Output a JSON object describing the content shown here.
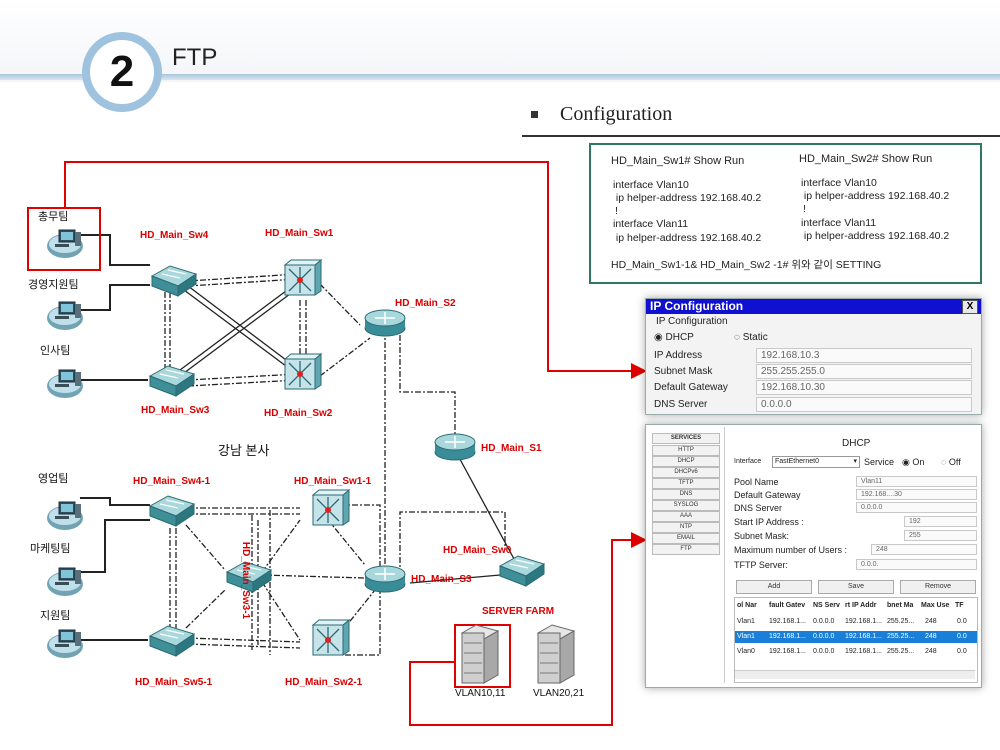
{
  "slide": {
    "number": "2",
    "title": "FTP"
  },
  "config": {
    "heading": "Configuration",
    "sw1_title": "HD_Main_Sw1# Show Run",
    "sw2_title": "HD_Main_Sw2# Show Run",
    "sw1_lines": [
      "interface Vlan10",
      " ip helper-address 192.168.40.2",
      "!",
      "interface Vlan11",
      " ip helper-address 192.168.40.2"
    ],
    "sw2_lines": [
      "interface Vlan10",
      " ip helper-address 192.168.40.2",
      "!",
      "interface Vlan11",
      " ip helper-address 192.168.40.2"
    ],
    "note": "HD_Main_Sw1-1& HD_Main_Sw2 -1# 위와 같이 SETTING"
  },
  "network": {
    "devices": {
      "sw4": "HD_Main_Sw4",
      "sw1": "HD_Main_Sw1",
      "s2": "HD_Main_S2",
      "sw3": "HD_Main_Sw3",
      "sw2": "HD_Main_Sw2",
      "s1": "HD_Main_S1",
      "sw41": "HD_Main_Sw4-1",
      "sw11": "HD_Main_Sw1-1",
      "sw31": "HD_Main_Sw3-1",
      "sw0": "HD_Main_Sw0",
      "s3": "HD_Main_S3",
      "server_farm": "SERVER FARM",
      "sw51": "HD_Main_Sw5-1",
      "sw21": "HD_Main_Sw2-1"
    },
    "teams": {
      "general": "총무팀",
      "management": "경영지원팀",
      "hr": "인사팀",
      "sales": "영업팀",
      "marketing": "마케팅팀",
      "support": "지원팀"
    },
    "site": "강남 본사",
    "servers": {
      "server1": "VLAN10,11",
      "server2": "VLAN20,21"
    },
    "colors": {
      "label_red": "#d80000",
      "link_red": "#e00000"
    }
  },
  "ip_window": {
    "title": "IP Configuration",
    "close": "X",
    "section": "IP Configuration",
    "dhcp_label": "DHCP",
    "static_label": "Static",
    "mode": "DHCP",
    "fields": [
      {
        "label": "IP Address",
        "value": "192.168.10.3"
      },
      {
        "label": "Subnet Mask",
        "value": "255.255.255.0"
      },
      {
        "label": "Default Gateway",
        "value": "192.168.10.30"
      },
      {
        "label": "DNS Server",
        "value": "0.0.0.0"
      }
    ]
  },
  "dhcp_window": {
    "title": "DHCP",
    "services": [
      "SERVICES",
      "HTTP",
      "DHCP",
      "DHCPv6",
      "TFTP",
      "DNS",
      "SYSLOG",
      "AAA",
      "NTP",
      "EMAIL",
      "FTP"
    ],
    "interface_label": "Interface",
    "interface_value": "FastEthernet0",
    "service_label": "Service",
    "on_label": "On",
    "off_label": "Off",
    "service_state": "On",
    "fields": [
      {
        "label": "Pool Name",
        "value": "Vlan11"
      },
      {
        "label": "Default Gateway",
        "value": "192.168....30"
      },
      {
        "label": "DNS Server",
        "value": "0.0.0.0"
      },
      {
        "label": "Start IP Address :",
        "value": "192"
      },
      {
        "label": "Subnet Mask:",
        "value": "255"
      },
      {
        "label": "Maximum number of Users :",
        "value": "248"
      },
      {
        "label": "TFTP Server:",
        "value": "0.0.0."
      }
    ],
    "buttons": [
      "Add",
      "Save",
      "Remove"
    ],
    "table_headers": [
      "ol Nar",
      "fault Gatev",
      "NS Serv",
      "rt IP Addr",
      "bnet Ma",
      "Max Use",
      "TF"
    ],
    "table_rows": [
      [
        "Vlan1",
        "192.168.1...",
        "0.0.0.0",
        "192.168.1...",
        "255.25...",
        "248",
        "0.0"
      ],
      [
        "Vlan1",
        "192.168.1...",
        "0.0.0.0",
        "192.168.1...",
        "255.25...",
        "248",
        "0.0"
      ],
      [
        "Vlan0",
        "192.168.1...",
        "0.0.0.0",
        "192.168.1...",
        "255.25...",
        "248",
        "0.0"
      ]
    ]
  }
}
